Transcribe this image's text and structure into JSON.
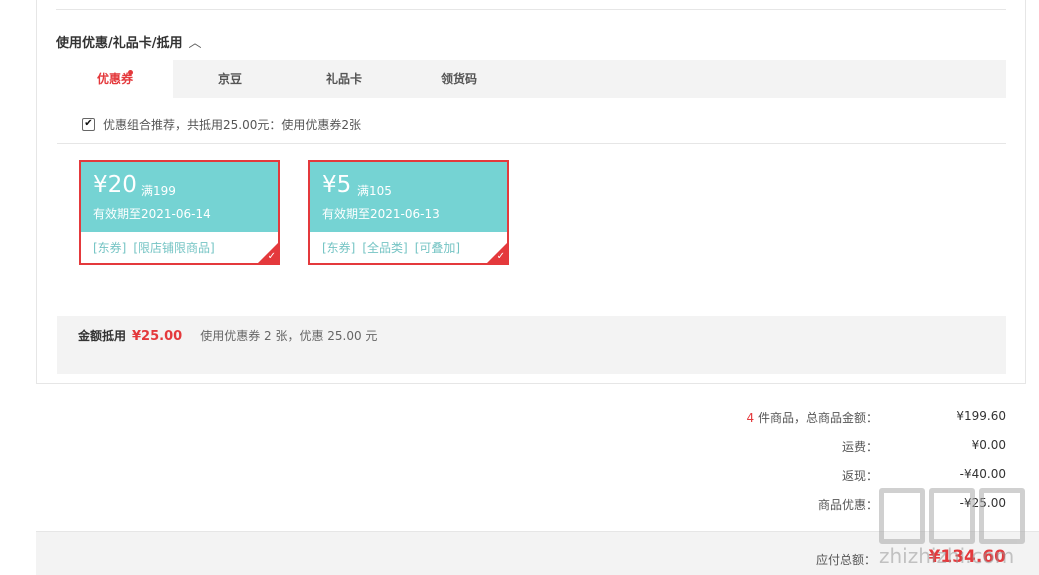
{
  "section": {
    "title": "使用优惠/礼品卡/抵用",
    "chevron": "︿"
  },
  "tabs": [
    {
      "label": "优惠券",
      "active": true,
      "has_dot": true
    },
    {
      "label": "京豆",
      "active": false
    },
    {
      "label": "礼品卡",
      "active": false
    },
    {
      "label": "领货码",
      "active": false
    }
  ],
  "combo": {
    "checked": true,
    "text": "优惠组合推荐，共抵用25.00元：使用优惠券2张"
  },
  "coupons": [
    {
      "amount": "¥20",
      "condition": "满199",
      "validity": "有效期至2021-06-14",
      "tags": [
        "[东券]",
        "[限店铺限商品]"
      ],
      "selected": true
    },
    {
      "amount": "¥5",
      "condition": "满105",
      "validity": "有效期至2021-06-13",
      "tags": [
        "[东券]",
        "[全品类]",
        "[可叠加]"
      ],
      "selected": true
    }
  ],
  "summary": {
    "label": "金额抵用",
    "amount": "¥25.00",
    "text": "使用优惠券 2 张，优惠 25.00 元"
  },
  "totals": {
    "count": "4",
    "goods_label": " 件商品，总商品金额：",
    "goods_value": "¥199.60",
    "shipping_label": "运费：",
    "shipping_value": "¥0.00",
    "cashback_label": "返现：",
    "cashback_value": "-¥40.00",
    "discount_label": "商品优惠：",
    "discount_value": "-¥25.00"
  },
  "payable": {
    "label": "应付总额：",
    "value": "¥134.60"
  },
  "watermark": {
    "text": "zhizhizhi.com"
  },
  "colors": {
    "accent": "#e4393c",
    "coupon_bg": "#75d3d3",
    "bar_bg": "#f3f3f3"
  }
}
